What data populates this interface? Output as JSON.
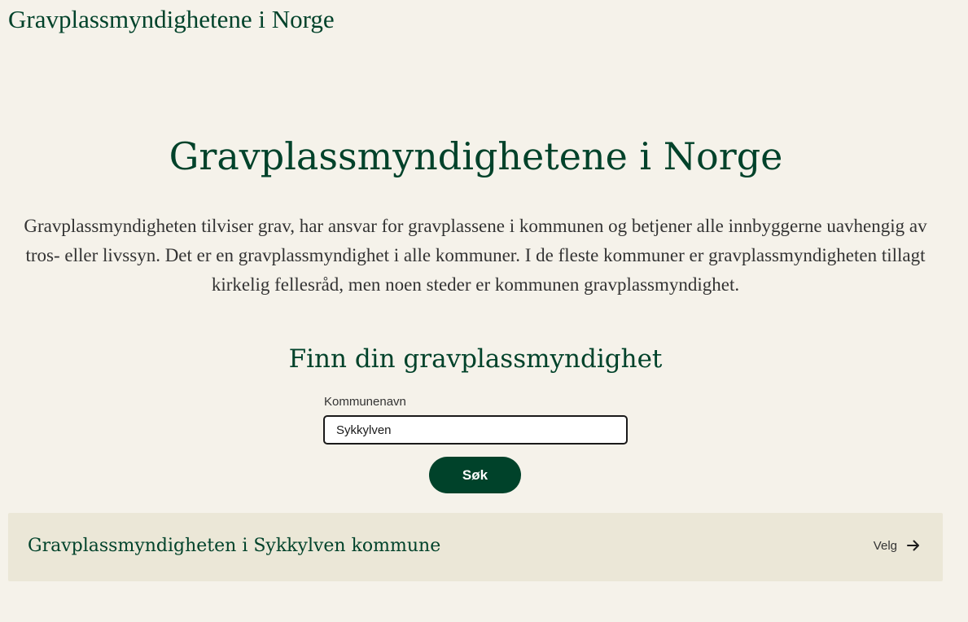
{
  "header": {
    "site_title": "Gravplassmyndighetene i Norge"
  },
  "main": {
    "title": "Gravplassmyndighetene i Norge",
    "intro": "Gravplassmyndigheten tilviser grav, har ansvar for gravplassene i kommunen og betjener alle innbyggerne uavhengig av tros- eller livssyn. Det er en gravplassmyndighet i alle kommuner. I de fleste kommuner er gravplassmyndigheten tillagt kirkelig fellesråd, men noen steder er kommunen gravplassmyndighet.",
    "search_heading": "Finn din gravplassmyndighet"
  },
  "search": {
    "label": "Kommunenavn",
    "value": "Sykkylven",
    "button_label": "Søk"
  },
  "results": [
    {
      "name": "Gravplassmyndigheten i Sykkylven kommune",
      "action_label": "Velg",
      "action_icon": "arrow-right-icon"
    }
  ],
  "colors": {
    "brand": "#00422a",
    "background": "#f5f2ea",
    "result_background": "#ebe7d7"
  }
}
